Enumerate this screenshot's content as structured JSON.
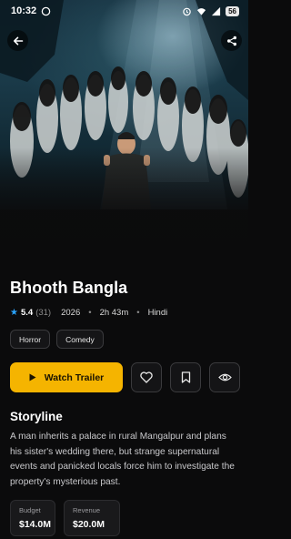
{
  "status_bar": {
    "time": "10:32",
    "battery": "56"
  },
  "movie": {
    "title": "Bhooth Bangla",
    "rating": "5.4",
    "rating_count": "(31)",
    "year": "2026",
    "duration": "2h 43m",
    "language": "Hindi",
    "genres": [
      "Horror",
      "Comedy"
    ]
  },
  "actions": {
    "watch_trailer": "Watch Trailer"
  },
  "storyline": {
    "heading": "Storyline",
    "text": "A man inherits a palace in rural Mangalpur and plans his sister's wedding there, but strange supernatural events and panicked locals force him to investigate the property's mysterious past."
  },
  "stats": [
    {
      "label": "Budget",
      "value": "$14.0M"
    },
    {
      "label": "Revenue",
      "value": "$20.0M"
    }
  ],
  "icons": {
    "back": "arrow-left-icon",
    "share": "share-icon",
    "play": "play-icon",
    "like": "heart-icon",
    "bookmark": "bookmark-icon",
    "watch": "eye-icon"
  },
  "colors": {
    "accent": "#f5b400",
    "star": "#2aa3ff",
    "background": "#0b0b0c"
  }
}
